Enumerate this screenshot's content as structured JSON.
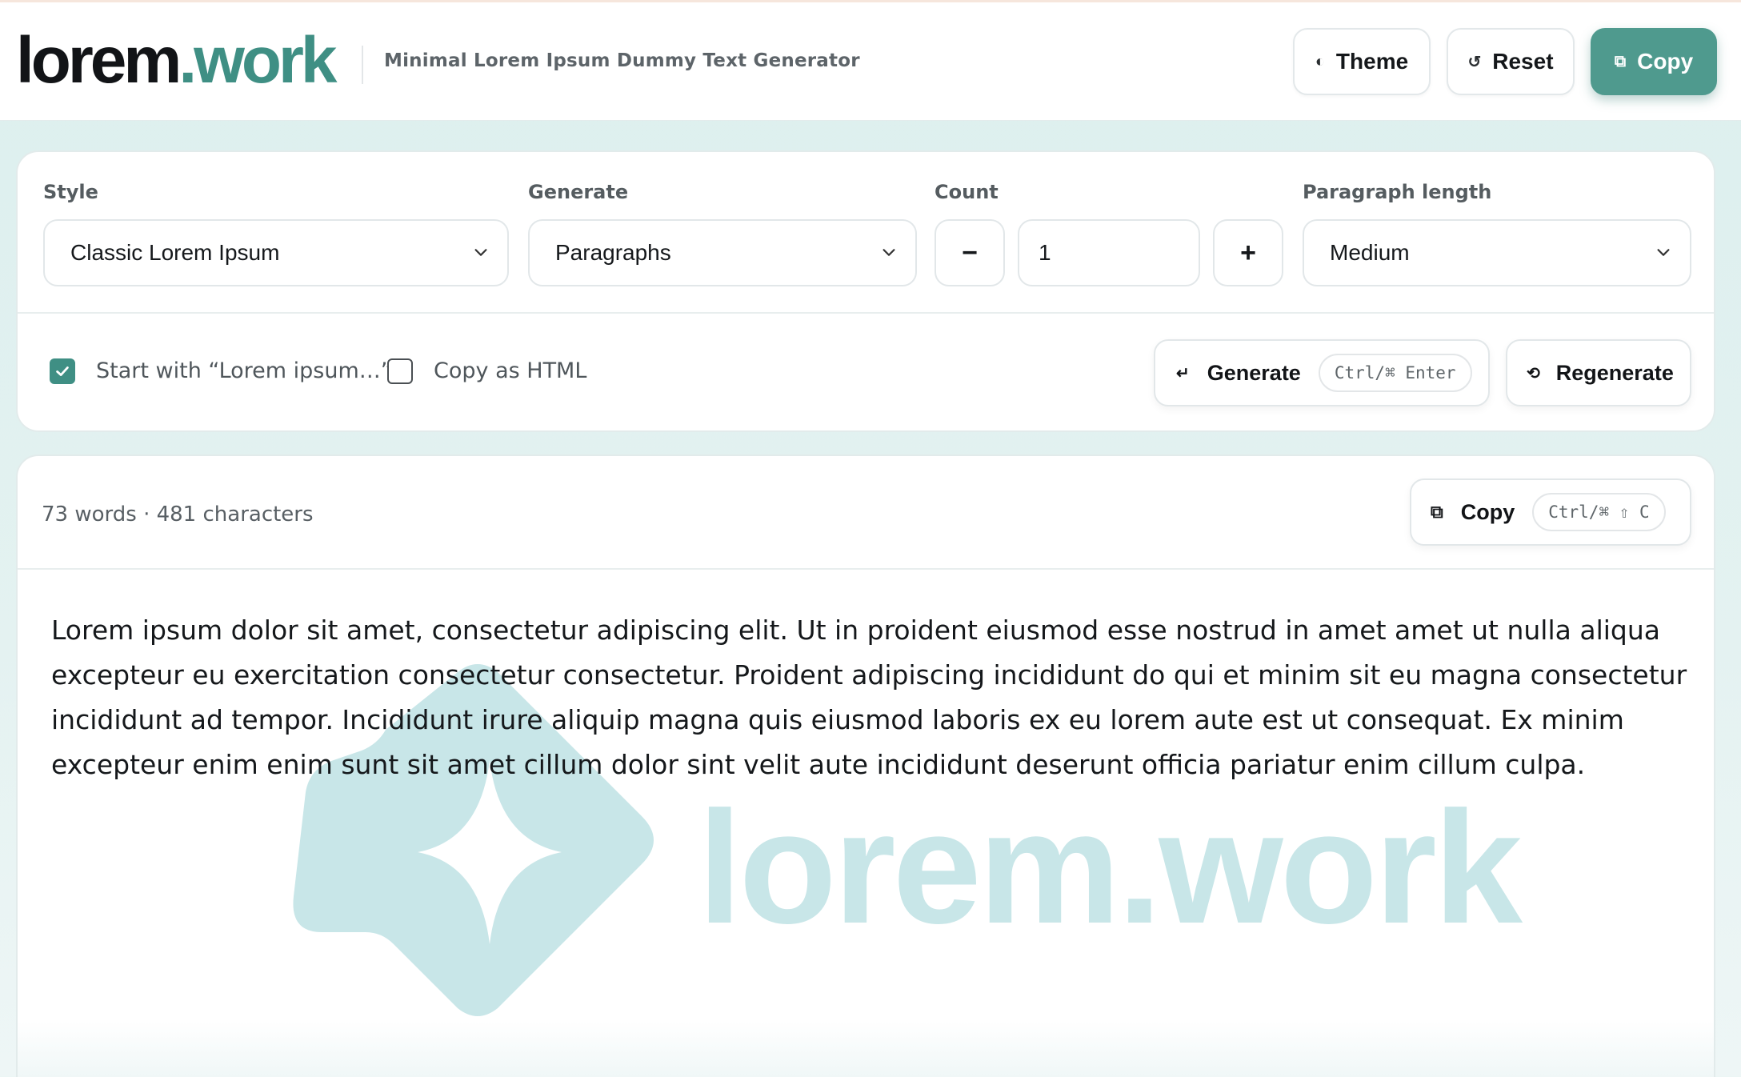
{
  "brand": {
    "name_part1": "lorem",
    "name_part2": ".work",
    "tagline": "Minimal Lorem Ipsum Dummy Text Generator",
    "watermark_text": "lorem.work",
    "accent_color": "#3f8f84"
  },
  "header": {
    "theme_label": "Theme",
    "theme_icon": "half-circle-icon",
    "reset_label": "Reset",
    "reset_icon": "refresh-icon",
    "copy_label": "Copy",
    "copy_icon": "copy-icon"
  },
  "controls": {
    "style_label": "Style",
    "style_value": "Classic Lorem Ipsum",
    "generate_label": "Generate",
    "generate_value": "Paragraphs",
    "count_label": "Count",
    "count_value": "1",
    "decrement_symbol": "−",
    "increment_symbol": "+",
    "length_label": "Paragraph length",
    "length_value": "Medium"
  },
  "options": {
    "start_with_label": "Start with “Lorem ipsum…”",
    "start_with_checked": true,
    "copy_html_label": "Copy as HTML",
    "copy_html_checked": false,
    "generate_button": "Generate",
    "generate_shortcut": "Ctrl/⌘ Enter",
    "regenerate_button": "Regenerate"
  },
  "output": {
    "stats": "73 words · 481 characters",
    "copy_button": "Copy",
    "copy_shortcut": "Ctrl/⌘ ⇧ C",
    "text": "Lorem ipsum dolor sit amet, consectetur adipiscing elit. Ut in proident eiusmod esse nostrud in amet amet ut nulla aliqua excepteur eu exercitation consectetur consectetur. Proident adipiscing incididunt do qui et minim sit eu magna consectetur incididunt ad tempor. Incididunt irure aliquip magna quis eiusmod laboris ex eu lorem aute est ut consequat. Ex minim excepteur enim enim sunt sit amet cillum dolor sint velit aute incididunt deserunt officia pariatur enim cillum culpa."
  }
}
